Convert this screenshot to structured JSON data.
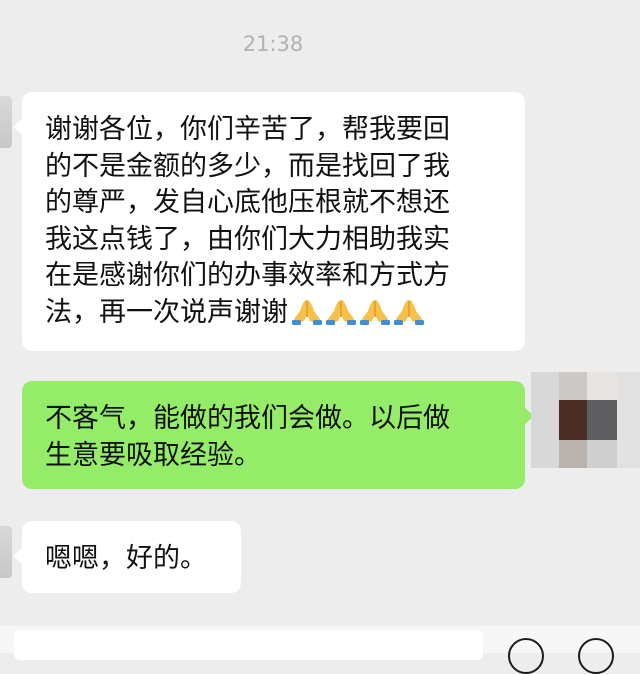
{
  "chat": {
    "timestamp": "21:38",
    "messages": [
      {
        "side": "received",
        "lines": [
          "谢谢各位，你们辛苦了，帮我要回",
          "的不是金额的多少，而是找回了我",
          "的尊严，发自心底他压根就不想还",
          "我这点钱了，由你们大力相助我实",
          "在是感谢你们的办事效率和方式方",
          "法，再一次说声谢谢"
        ],
        "emoji": [
          "folded-hands",
          "folded-hands",
          "folded-hands",
          "folded-hands"
        ]
      },
      {
        "side": "sent",
        "lines": [
          "不客气，能做的我们会做。以后做",
          "生意要吸取经验。"
        ]
      },
      {
        "side": "received",
        "lines": [
          "嗯嗯，好的。"
        ]
      }
    ]
  },
  "input_bar": {
    "icons": [
      "emoji-icon",
      "add-icon"
    ]
  },
  "colors": {
    "background": "#ededed",
    "received_bubble": "#ffffff",
    "sent_bubble": "#95ec69",
    "timestamp_text": "#b2b2b2"
  }
}
